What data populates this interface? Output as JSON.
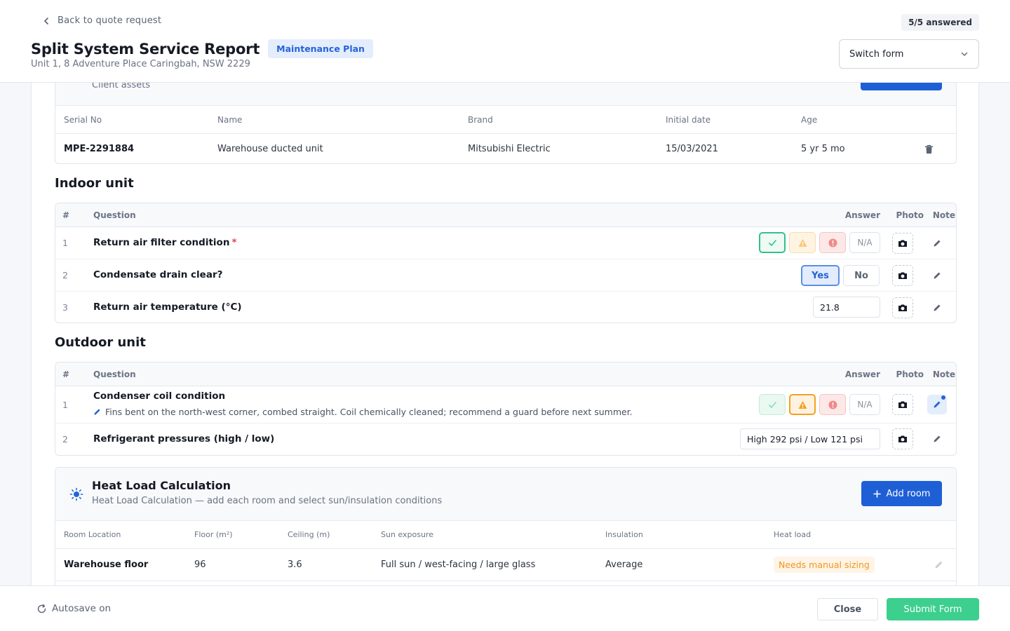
{
  "header": {
    "back_label": "Back to quote request",
    "title": "Split System Service Report",
    "plan_badge": "Maintenance Plan",
    "address": "Unit 1, 8 Adventure Place Caringbah, NSW 2229",
    "answered": "5/5 answered",
    "switch_form_label": "Switch form"
  },
  "assets": {
    "subtitle": "Client assets",
    "columns": [
      "Serial No",
      "Name",
      "Brand",
      "Initial date",
      "Age"
    ],
    "rows": [
      {
        "serial": "MPE-2291884",
        "name": "Warehouse ducted unit",
        "brand": "Mitsubishi Electric",
        "initial_date": "15/03/2021",
        "age": "5 yr 5 mo"
      }
    ]
  },
  "indoor": {
    "title": "Indoor unit",
    "columns": {
      "num": "#",
      "question": "Question",
      "answer": "Answer",
      "photo": "Photo",
      "note": "Note"
    },
    "questions": [
      {
        "num": "1",
        "text": "Return air filter condition",
        "required": "*",
        "answer": "ok",
        "na_label": "N/A"
      },
      {
        "num": "2",
        "text": "Condensate drain clear?",
        "yes_label": "Yes",
        "no_label": "No",
        "answer": "Yes"
      },
      {
        "num": "3",
        "text": "Return air temperature (°C)",
        "value": "21.8"
      }
    ]
  },
  "outdoor": {
    "title": "Outdoor unit",
    "columns": {
      "num": "#",
      "question": "Question",
      "answer": "Answer",
      "photo": "Photo",
      "note": "Note"
    },
    "questions": [
      {
        "num": "1",
        "text": "Condenser coil condition",
        "note": "Fins bent on the north-west corner, combed straight. Coil chemically cleaned; recommend a guard before next summer.",
        "answer": "warn",
        "na_label": "N/A"
      },
      {
        "num": "2",
        "text": "Refrigerant pressures (high / low)",
        "value": "High 292 psi / Low 121 psi"
      }
    ]
  },
  "heat_load": {
    "title": "Heat Load Calculation",
    "subtitle": "Heat Load Calculation — add each room and select sun/insulation conditions",
    "add_label": "Add room",
    "columns": [
      "Room Location",
      "Floor (m²)",
      "Ceiling (m)",
      "Sun exposure",
      "Insulation",
      "Heat load"
    ],
    "rows": [
      {
        "room": "Warehouse floor",
        "floor": "96",
        "ceiling": "3.6",
        "sun": "Full sun / west-facing / large glass",
        "insulation": "Average",
        "heat_load": "Needs manual sizing"
      }
    ]
  },
  "footer": {
    "autosave": "Autosave on",
    "close_label": "Close",
    "submit_label": "Submit Form"
  },
  "colors": {
    "primary": "#1f5fd6",
    "success": "#3ccf8e",
    "warning": "#f5a021",
    "danger": "#e0454d"
  }
}
